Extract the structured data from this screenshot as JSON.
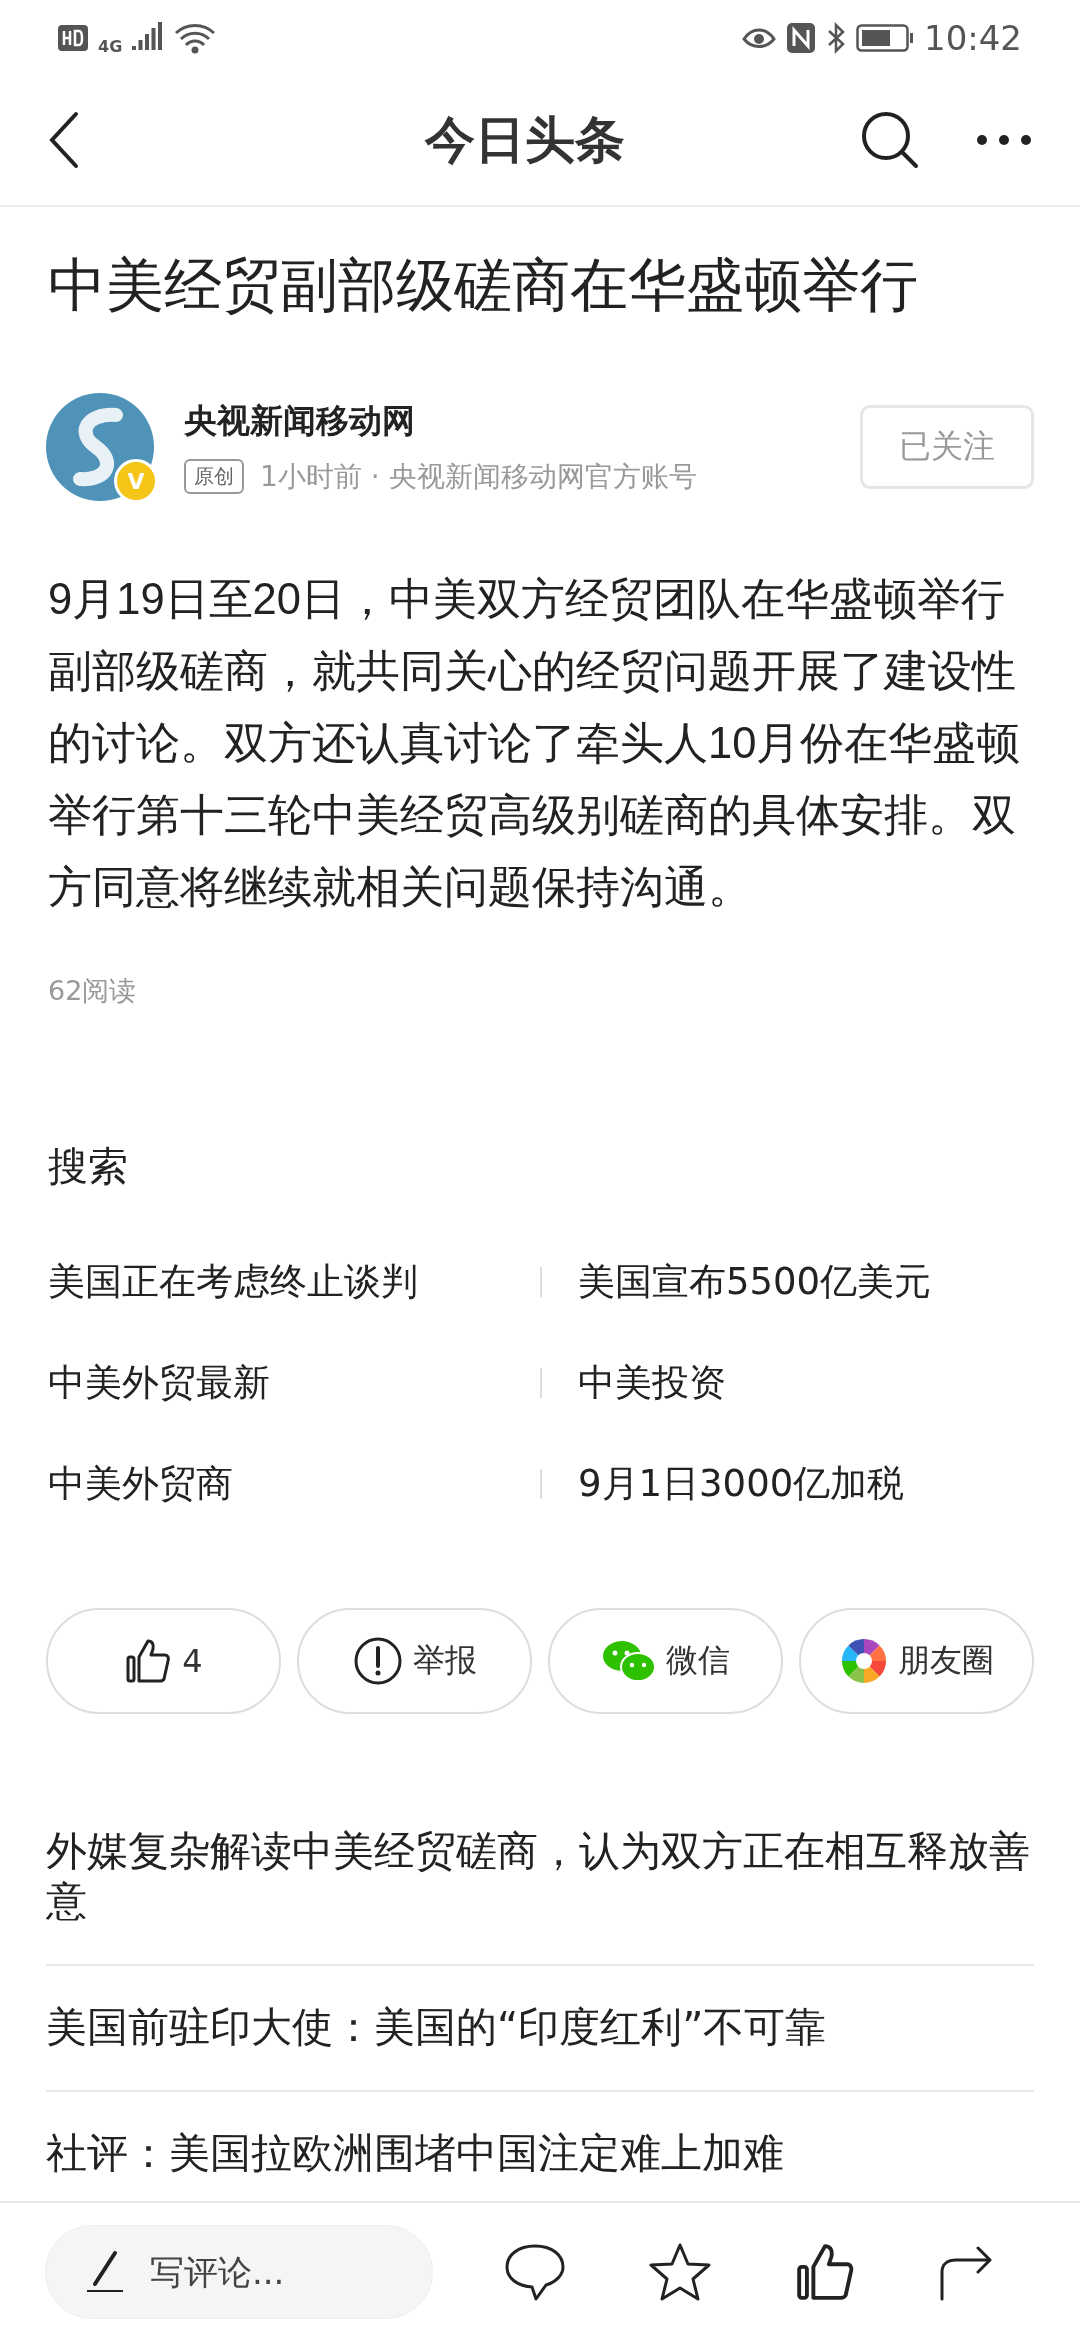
{
  "status_bar": {
    "network": "4G",
    "time": "10:42"
  },
  "header": {
    "title": "今日头条"
  },
  "article": {
    "title": "中美经贸副部级磋商在华盛顿举行",
    "author": {
      "name": "央视新闻移动网",
      "badge": "V",
      "tag": "原创",
      "meta": "1小时前 · 央视新闻移动网官方账号",
      "follow": {
        "label": "已关注",
        "selected": true
      }
    },
    "body": "9月19日至20日，中美双方经贸团队在华盛顿举行副部级磋商，就共同关心的经贸问题开展了建设性的讨论。双方还认真讨论了牵头人10月份在华盛顿举行第十三轮中美经贸高级别磋商的具体安排。双方同意将继续就相关问题保持沟通。",
    "reads": "62阅读"
  },
  "search": {
    "heading": "搜索",
    "terms": [
      [
        "美国正在考虑终止谈判",
        "美国宣布5500亿美元"
      ],
      [
        "中美外贸最新",
        "中美投资"
      ],
      [
        "中美外贸商",
        "9月1日3000亿加税"
      ]
    ]
  },
  "actions": [
    {
      "kind": "like",
      "label": "4"
    },
    {
      "kind": "report",
      "label": "举报"
    },
    {
      "kind": "wechat",
      "label": "微信"
    },
    {
      "kind": "moments",
      "label": "朋友圈"
    }
  ],
  "related": [
    "外媒复杂解读中美经贸磋商，认为双方正在相互释放善意",
    "美国前驻印大使：美国的“印度红利”不可靠",
    "社评：美国拉欧洲围堵中国注定难上加难"
  ],
  "bottom_bar": {
    "comment_placeholder": "写评论..."
  }
}
